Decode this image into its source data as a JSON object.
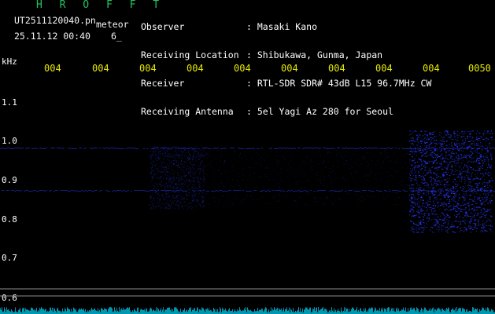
{
  "header": {
    "brand": "H R O F F T",
    "filename": "UT2511120040.pn",
    "format": "meteor",
    "timestamp": "25.11.12 00:40",
    "count": "6_",
    "fields": [
      {
        "label": "Observer",
        "value": ": Masaki Kano"
      },
      {
        "label": "Receiving Location",
        "value": ": Shibukawa, Gunma, Japan"
      },
      {
        "label": "Receiver",
        "value": ": RTL-SDR SDR# 43dB L15 96.7MHz CW"
      },
      {
        "label": "Receiving Antenna",
        "value": ": 5el Yagi Az 280 for Seoul"
      }
    ]
  },
  "y_axis": {
    "unit": "kHz",
    "ticks": [
      "1.1",
      "1.0",
      "0.9",
      "0.8",
      "0.7",
      "0.6"
    ]
  },
  "x_axis": {
    "ticks": [
      "004",
      "004",
      "004",
      "004",
      "004",
      "004",
      "004",
      "004",
      "004",
      "0050"
    ]
  },
  "colors": {
    "background": "#000000",
    "brand": "#22c55e",
    "tick_x": "#e5e800",
    "signal": "#2b3bff",
    "baseline": "#00d7ff"
  }
}
